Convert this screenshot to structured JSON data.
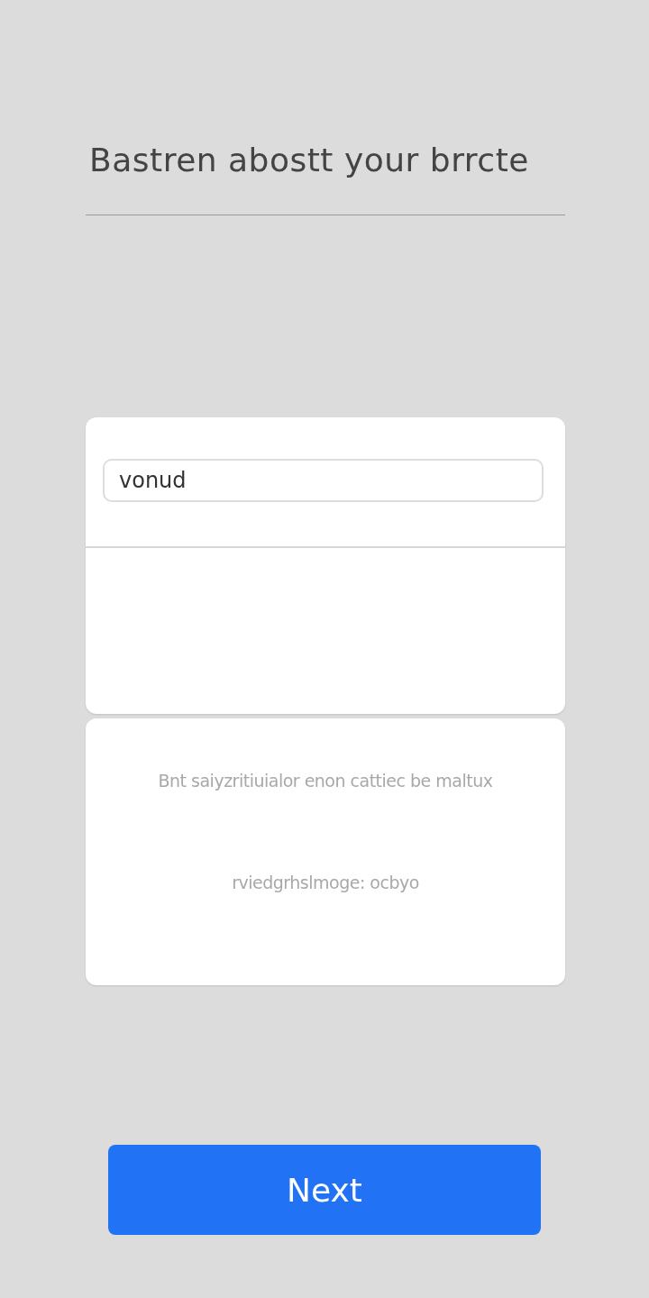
{
  "heading": "Bastren abostt your brrcte",
  "form_card": {
    "input_value": "vonud"
  },
  "info_card": {
    "lines": [
      "Bnt saiyzritiuialor enon cattiec be maltux",
      "rviedgrhslmoge: ocbyo"
    ]
  },
  "next_button": {
    "label": "Next"
  }
}
